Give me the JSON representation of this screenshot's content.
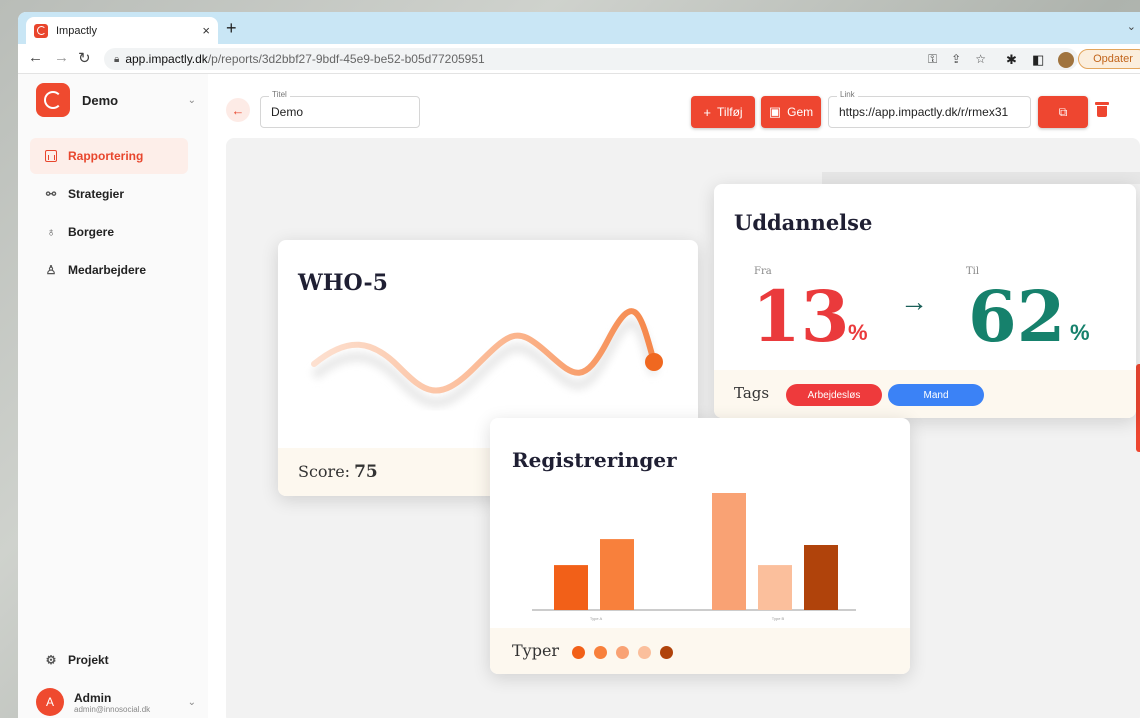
{
  "browser": {
    "tab_title": "Impactly",
    "tab_close": "×",
    "new_tab": "+",
    "url_host": "app.impactly.dk",
    "url_path": "/p/reports/3d2bbf27-9bdf-45e9-be52-b05d77205951",
    "update_label": "Opdater"
  },
  "sidebar": {
    "org_name": "Demo",
    "items": [
      {
        "label": "Rapportering",
        "icon": "report-icon",
        "active": true
      },
      {
        "label": "Strategier",
        "icon": "strategy-icon",
        "active": false
      },
      {
        "label": "Borgere",
        "icon": "citizens-icon",
        "active": false
      },
      {
        "label": "Medarbejdere",
        "icon": "employees-icon",
        "active": false
      }
    ],
    "project_label": "Projekt",
    "user": {
      "initial": "A",
      "name": "Admin",
      "email": "admin@innosocial.dk"
    }
  },
  "toolbar": {
    "title_label": "Titel",
    "title_value": "Demo",
    "add_label": "Tilføj",
    "save_label": "Gem",
    "link_label": "Link",
    "link_value": "https://app.impactly.dk/r/rmex31"
  },
  "who5": {
    "title": "WHO-5",
    "score_label": "Score:",
    "score_value": "75"
  },
  "uddannelse": {
    "title": "Uddannelse",
    "from_label": "Fra",
    "to_label": "Til",
    "from_value": "13",
    "to_value": "62",
    "unit": "%",
    "tags_label": "Tags",
    "tags": [
      "Arbejdesløs",
      "Mand"
    ]
  },
  "registreringer": {
    "title": "Registreringer",
    "types_label": "Typer",
    "type_colors": [
      "#f26018",
      "#f8803c",
      "#f9a274",
      "#fbbf9c",
      "#b0430b"
    ]
  },
  "chart_data": {
    "type": "bar",
    "categories": [
      "Type A",
      "Type B"
    ],
    "series": [
      {
        "values": [
          38,
          60
        ],
        "color": "#f26018"
      },
      {
        "values": [
          0,
          0
        ],
        "color": "#f8803c"
      },
      {
        "values": [
          0,
          99
        ],
        "color": "#f9a274"
      },
      {
        "values": [
          0,
          38
        ],
        "color": "#fbbf9c"
      },
      {
        "values": [
          0,
          55
        ],
        "color": "#b0430b"
      }
    ],
    "values_group1": [
      38,
      60
    ],
    "values_group2": [
      99,
      38,
      55
    ],
    "colors_group1": [
      "#f26018",
      "#f8803c"
    ],
    "colors_group2": [
      "#f9a274",
      "#fbbf9c",
      "#b0430b"
    ],
    "tick_labels": [
      "Type A",
      "Type B"
    ],
    "ylim": [
      0,
      110
    ],
    "grid": false,
    "legend": "bottom"
  },
  "colors": {
    "accent": "#ee4630",
    "from_color": "#ea3a3c",
    "to_color": "#16816c"
  }
}
